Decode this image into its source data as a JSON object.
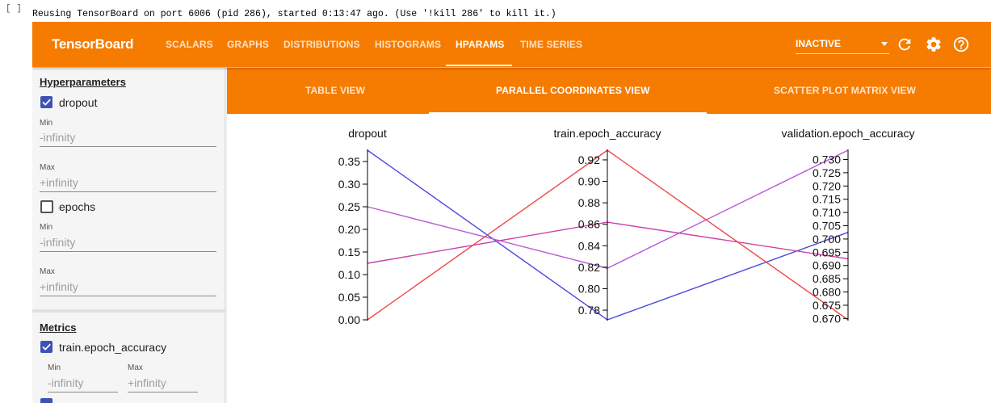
{
  "cell": {
    "prompt": "[ ]",
    "output": "Reusing TensorBoard on port 6006 (pid 286), started 0:13:47 ago. (Use '!kill 286' to kill it.)"
  },
  "topbar": {
    "brand": "TensorBoard",
    "tabs": [
      "SCALARS",
      "GRAPHS",
      "DISTRIBUTIONS",
      "HISTOGRAMS",
      "HPARAMS",
      "TIME SERIES"
    ],
    "active_tab": "HPARAMS",
    "run_state": "INACTIVE",
    "icons": [
      "refresh-icon",
      "settings-icon",
      "help-icon"
    ],
    "color": "#f57c00"
  },
  "sidebar": {
    "hyperparameters": {
      "title": "Hyperparameters",
      "items": [
        {
          "name": "dropout",
          "checked": true,
          "min_label": "Min",
          "min_placeholder": "-infinity",
          "max_label": "Max",
          "max_placeholder": "+infinity"
        },
        {
          "name": "epochs",
          "checked": false,
          "min_label": "Min",
          "min_placeholder": "-infinity",
          "max_label": "Max",
          "max_placeholder": "+infinity"
        }
      ]
    },
    "metrics": {
      "title": "Metrics",
      "items": [
        {
          "name": "train.epoch_accuracy",
          "checked": true,
          "min_label": "Min",
          "min_placeholder": "-infinity",
          "max_label": "Max",
          "max_placeholder": "+infinity"
        }
      ]
    }
  },
  "views": {
    "tabs": [
      "TABLE VIEW",
      "PARALLEL COORDINATES VIEW",
      "SCATTER PLOT MATRIX VIEW"
    ],
    "active": "PARALLEL COORDINATES VIEW"
  },
  "chart_data": {
    "type": "parallel-coordinates",
    "axes": [
      {
        "title": "dropout",
        "range": [
          0.0,
          0.375
        ],
        "ticks": [
          0.0,
          0.05,
          0.1,
          0.15,
          0.2,
          0.25,
          0.3,
          0.35
        ],
        "tick_labels": [
          "0.00",
          "0.05",
          "0.10",
          "0.15",
          "0.20",
          "0.25",
          "0.30",
          "0.35"
        ]
      },
      {
        "title": "train.epoch_accuracy",
        "range": [
          0.771,
          0.929
        ],
        "ticks": [
          0.78,
          0.8,
          0.82,
          0.84,
          0.86,
          0.88,
          0.9,
          0.92
        ],
        "tick_labels": [
          "0.78",
          "0.80",
          "0.82",
          "0.84",
          "0.86",
          "0.88",
          "0.90",
          "0.92"
        ]
      },
      {
        "title": "validation.epoch_accuracy",
        "range": [
          0.6695,
          0.7335
        ],
        "ticks": [
          0.67,
          0.675,
          0.68,
          0.685,
          0.69,
          0.695,
          0.7,
          0.705,
          0.71,
          0.715,
          0.72,
          0.725,
          0.73
        ],
        "tick_labels": [
          "0.670",
          "0.675",
          "0.680",
          "0.685",
          "0.690",
          "0.695",
          "0.700",
          "0.705",
          "0.710",
          "0.715",
          "0.720",
          "0.725",
          "0.730"
        ]
      }
    ],
    "lines": [
      {
        "color": "#4a4ae0",
        "values": [
          0.375,
          0.771,
          0.7025
        ]
      },
      {
        "color": "#b85ad6",
        "values": [
          0.25,
          0.819,
          0.7335
        ]
      },
      {
        "color": "#cc44a8",
        "values": [
          0.125,
          0.862,
          0.6925
        ]
      },
      {
        "color": "#ee4a4a",
        "values": [
          0.0,
          0.929,
          0.6695
        ]
      }
    ]
  }
}
